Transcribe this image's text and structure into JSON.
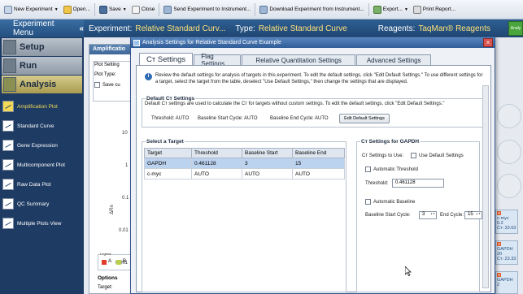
{
  "toolbar": {
    "items": [
      {
        "label": "New Experiment",
        "icon": "new-experiment-icon",
        "dropdown": true
      },
      {
        "label": "Open...",
        "icon": "folder-open-icon",
        "dropdown": false
      },
      {
        "label": "Save",
        "icon": "save-icon",
        "dropdown": true
      },
      {
        "label": "Close",
        "icon": "close-document-icon",
        "dropdown": false
      },
      {
        "label": "Send Experiment to Instrument...",
        "icon": "send-icon",
        "dropdown": false
      },
      {
        "label": "Download Experiment from Instrument...",
        "icon": "download-icon",
        "dropdown": false
      },
      {
        "label": "Export...",
        "icon": "export-icon",
        "dropdown": true
      },
      {
        "label": "Print Report...",
        "icon": "print-icon",
        "dropdown": false
      }
    ]
  },
  "header": {
    "experiment_label": "Experiment:",
    "experiment_value": "Relative Standard Curv...",
    "type_label": "Type:",
    "type_value": "Relative Standard Curve",
    "reagents_label": "Reagents:",
    "reagents_value": "TaqMan® Reagents",
    "analyze_button": "Analy"
  },
  "sidebar": {
    "title": "Experiment Menu",
    "collapse": "«",
    "sections": [
      {
        "label": "Setup"
      },
      {
        "label": "Run"
      },
      {
        "label": "Analysis"
      }
    ],
    "items": [
      {
        "label": "Amplification Plot",
        "active": true
      },
      {
        "label": "Standard Curve",
        "active": false
      },
      {
        "label": "Gene Expression",
        "active": false
      },
      {
        "label": "Multicomponent Plot",
        "active": false
      },
      {
        "label": "Raw Data Plot",
        "active": false
      },
      {
        "label": "QC Summary",
        "active": false
      },
      {
        "label": "Multiple Plots View",
        "active": false
      }
    ]
  },
  "background": {
    "panel_title": "Amplificatio",
    "plot_settings": "Plot Setting",
    "plot_type": "Plot Type:",
    "save_cu": "Save cu",
    "rn_label": "ΔRn",
    "rn_ticks": [
      "10",
      "1",
      "0.1",
      "0.01",
      "0.001"
    ],
    "options": "Options",
    "target": "Target:",
    "legend": "Legend",
    "legend_a": "A",
    "legend_b": "B",
    "wells": [
      {
        "line1": "c-myc",
        "line2": "0.2",
        "line3": "Cт: 33.63"
      },
      {
        "line1": "GAPDH",
        "line2": "20",
        "line3": "Cт: 23.33"
      },
      {
        "line1": "GAPDH",
        "line2": "2",
        "line3": ""
      }
    ],
    "well_flag": "S"
  },
  "dialog": {
    "title": "Analysis Settings for Relative Standard Curve Example",
    "tabs": [
      {
        "label": "Cт Settings",
        "active": true
      },
      {
        "label": "Flag Settings",
        "active": false
      },
      {
        "label": "Relative Quantitation Settings",
        "active": false
      },
      {
        "label": "Advanced Settings",
        "active": false
      }
    ],
    "info": "Review the default settings for analysis of targets in this experiment. To edit the default settings, click \"Edit Default Settings.\" To use different settings for a target, select the target from the table, deselect \"Use Default Settings,\" then change the settings that are displayed.",
    "default_group": {
      "title": "Default Cт Settings",
      "desc": "Default Cт settings are used to calculate the Cт for targets without custom settings. To edit the default settings, click \"Edit Default Settings.\"",
      "threshold": "Threshold: AUTO",
      "baseline_start": "Baseline Start Cycle: AUTO",
      "baseline_end": "Baseline End Cycle: AUTO",
      "edit_button": "Edit Default Settings"
    },
    "target_group": {
      "title": "Select a Target",
      "columns": [
        "Target",
        "Threshold",
        "Baseline Start",
        "Baseline End"
      ],
      "rows": [
        {
          "target": "GAPDH",
          "threshold": "0.461128",
          "start": "3",
          "end": "15",
          "selected": true
        },
        {
          "target": "c-myc",
          "threshold": "AUTO",
          "start": "AUTO",
          "end": "AUTO",
          "selected": false
        }
      ]
    },
    "ct_group": {
      "title": "Cт Settings for GAPDH",
      "use_label": "Cт Settings to Use:",
      "use_default": "Use Default Settings",
      "auto_threshold": "Automatic Threshold",
      "threshold_label": "Threshold:",
      "threshold_value": "0.461128",
      "auto_baseline": "Automatic Baseline",
      "start_label": "Baseline Start Cycle:",
      "start_value": "3",
      "end_label": "End Cycle:",
      "end_value": "15"
    }
  },
  "colors": {
    "accent": "#f3d955",
    "title_bar": "#2f5d97",
    "sidebar": "#1e3b63",
    "selected_row": "#bcd3f0"
  }
}
